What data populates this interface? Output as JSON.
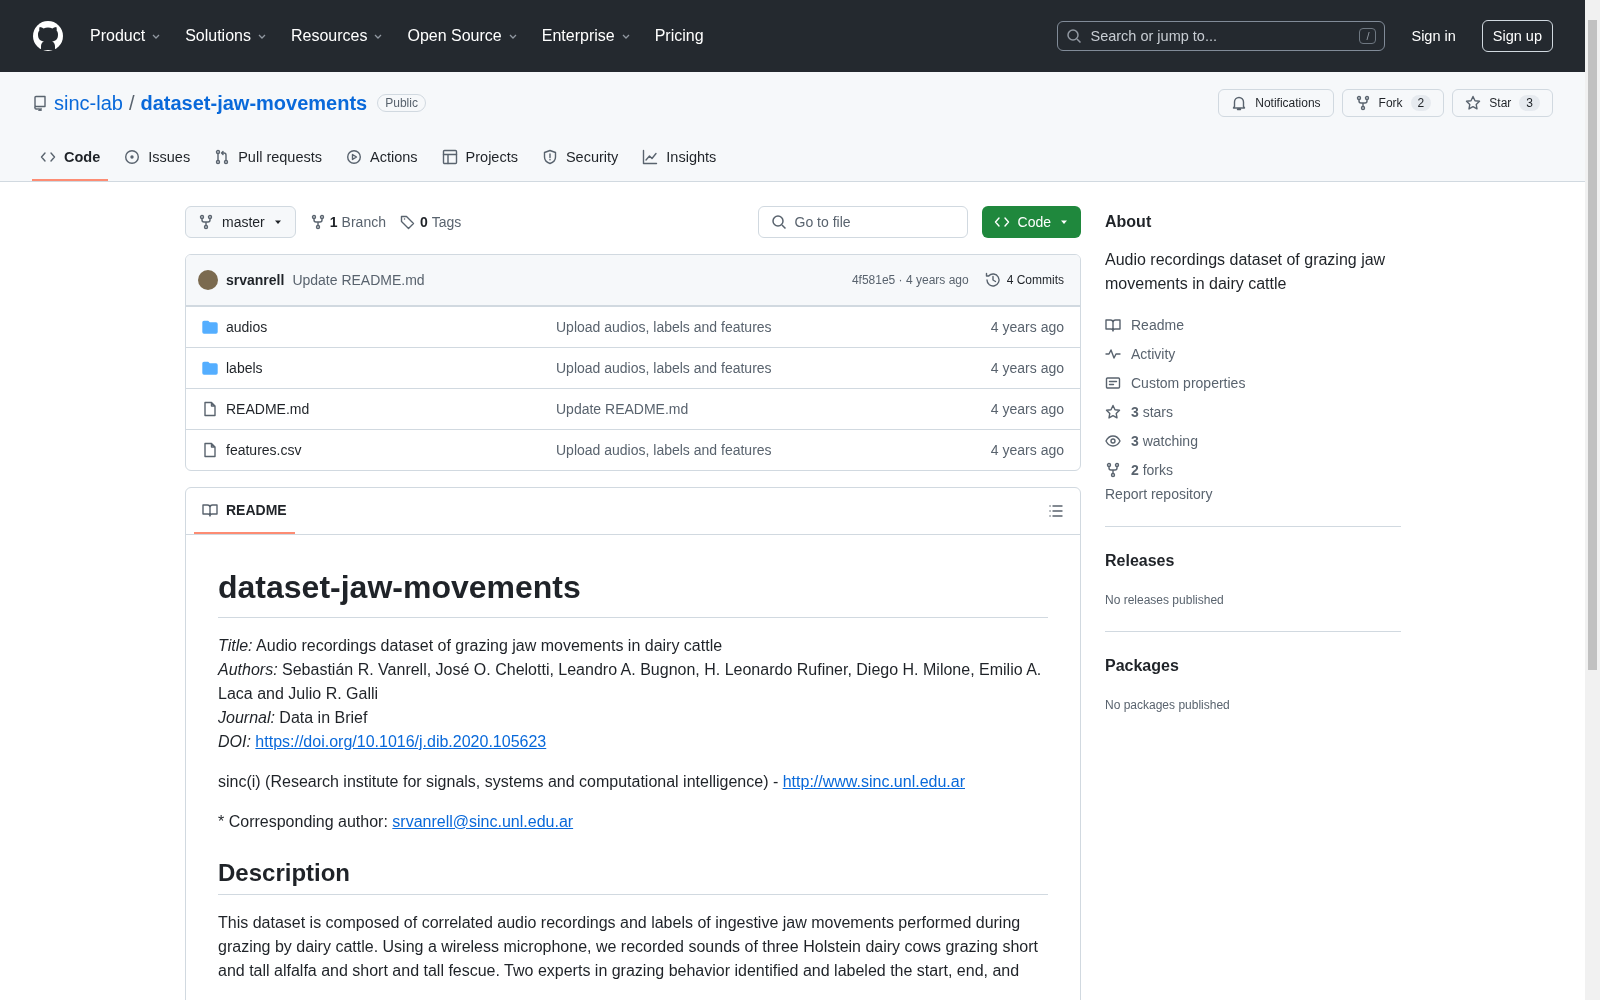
{
  "header": {
    "nav": [
      {
        "label": "Product",
        "dropdown": true
      },
      {
        "label": "Solutions",
        "dropdown": true
      },
      {
        "label": "Resources",
        "dropdown": true
      },
      {
        "label": "Open Source",
        "dropdown": true
      },
      {
        "label": "Enterprise",
        "dropdown": true
      },
      {
        "label": "Pricing",
        "dropdown": false
      }
    ],
    "search": {
      "placeholder": "Search or jump to...",
      "shortcut": "/"
    },
    "sign_in": "Sign in",
    "sign_up": "Sign up"
  },
  "repo": {
    "owner": "sinc-lab",
    "separator": "/",
    "name": "dataset-jaw-movements",
    "visibility": "Public",
    "actions": [
      {
        "kind": "bell",
        "label": "Notifications"
      },
      {
        "kind": "fork",
        "label": "Fork",
        "count": "2"
      },
      {
        "kind": "star",
        "label": "Star",
        "count": "3"
      }
    ],
    "tabs": [
      {
        "kind": "code",
        "label": "Code",
        "selected": true
      },
      {
        "kind": "issues",
        "label": "Issues",
        "selected": false
      },
      {
        "kind": "pr",
        "label": "Pull requests",
        "selected": false
      },
      {
        "kind": "actions",
        "label": "Actions",
        "selected": false
      },
      {
        "kind": "projects",
        "label": "Projects",
        "selected": false
      },
      {
        "kind": "security",
        "label": "Security",
        "selected": false
      },
      {
        "kind": "insights",
        "label": "Insights",
        "selected": false
      }
    ]
  },
  "toolbar": {
    "branch": "master",
    "branches_count": "1",
    "branches_label": "Branch",
    "tags_count": "0",
    "tags_label": "Tags",
    "go_to_file": "Go to file",
    "code_button": "Code"
  },
  "commit": {
    "author": "srvanrell",
    "message": "Update README.md",
    "hash_time": "4f581e5 · 4 years ago",
    "commits": "4 Commits"
  },
  "files": [
    {
      "kind": "folder",
      "name": "audios",
      "message": "Upload audios, labels and features",
      "time": "4 years ago"
    },
    {
      "kind": "folder",
      "name": "labels",
      "message": "Upload audios, labels and features",
      "time": "4 years ago"
    },
    {
      "kind": "file",
      "name": "README.md",
      "message": "Update README.md",
      "time": "4 years ago"
    },
    {
      "kind": "file",
      "name": "features.csv",
      "message": "Upload audios, labels and features",
      "time": "4 years ago"
    }
  ],
  "readme": {
    "tab": "README",
    "title": "dataset-jaw-movements",
    "meta": [
      {
        "text": "*Title:* Audio recordings dataset of grazing jaw movements in dairy cattle"
      },
      {
        "text": "*Authors:* Sebastián R. Vanrell, José O. Chelotti, Leandro A. Bugnon, H. Leonardo Rufiner, Diego H. Milone, Emilio A. Laca and Julio R. Galli"
      },
      {
        "text": "*Journal:* Data in Brief"
      },
      {
        "text": "*DOI:*",
        "link": "https://doi.org/10.1016/j.dib.2020.105623"
      }
    ],
    "paragraphs": [
      {
        "text": "sinc(i) (Research institute for signals, systems and computational intelligence) -",
        "link": "http://www.sinc.unl.edu.ar"
      },
      {
        "text": "* Corresponding author:",
        "link": "srvanrell@sinc.unl.edu.ar"
      }
    ],
    "section": "Description",
    "description": "This dataset is composed of correlated audio recordings and labels of ingestive jaw movements performed during grazing by dairy cattle. Using a wireless microphone, we recorded sounds of three Holstein dairy cows grazing short and tall alfalfa and short and tall fescue. Two experts in grazing behavior identified and labeled the start, end, and"
  },
  "about": {
    "title": "About",
    "description": "Audio recordings dataset of grazing jaw movements in dairy cattle",
    "links": [
      {
        "kind": "book",
        "label": "Readme"
      },
      {
        "kind": "pulse",
        "label": "Activity"
      },
      {
        "kind": "note",
        "label": "Custom properties"
      },
      {
        "kind": "star",
        "count": "3",
        "label": "stars"
      },
      {
        "kind": "eye",
        "count": "3",
        "label": "watching"
      },
      {
        "kind": "fork",
        "count": "2",
        "label": "forks"
      }
    ],
    "report": "Report repository"
  },
  "releases": {
    "title": "Releases",
    "empty": "No releases published"
  },
  "packages": {
    "title": "Packages",
    "empty": "No packages published"
  }
}
